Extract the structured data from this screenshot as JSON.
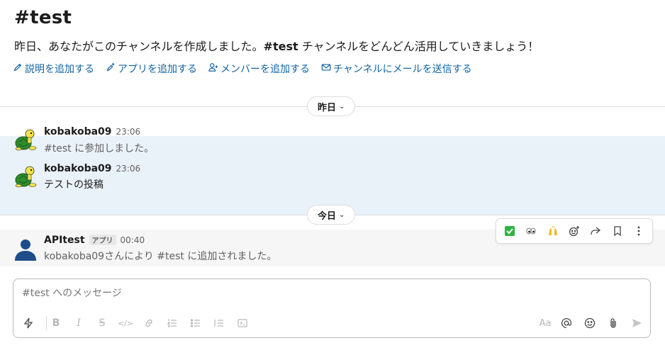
{
  "channel": {
    "title": "#test",
    "intro_before": "昨日、あなたがこのチャンネルを作成しました。",
    "intro_channel": "#test",
    "intro_after": " チャンネルをどんどん活用していきましょう！"
  },
  "actions": [
    {
      "label": "説明を追加する",
      "icon": "pencil-icon"
    },
    {
      "label": "アプリを追加する",
      "icon": "app-add-icon"
    },
    {
      "label": "メンバーを追加する",
      "icon": "person-add-icon"
    },
    {
      "label": "チャンネルにメールを送信する",
      "icon": "email-icon"
    }
  ],
  "dividers": {
    "yesterday": "昨日",
    "today": "今日"
  },
  "messages": [
    {
      "author": "kobakoba09",
      "time": "23:06",
      "text": "#test に参加しました。",
      "avatar": "turtle-avatar"
    },
    {
      "author": "kobakoba09",
      "time": "23:06",
      "text": "テストの投稿",
      "avatar": "turtle-avatar"
    },
    {
      "author": "APItest",
      "badge": "アプリ",
      "time": "00:40",
      "text": "kobakoba09さんにより #test に追加されました。",
      "avatar": "user-silhouette-avatar"
    }
  ],
  "hover_toolbar": [
    {
      "name": "check-mark-reaction",
      "glyph": "✅"
    },
    {
      "name": "eyes-reaction",
      "glyph": "👀"
    },
    {
      "name": "raised-hands-reaction",
      "glyph": "🙌"
    },
    {
      "name": "add-reaction-icon"
    },
    {
      "name": "share-icon"
    },
    {
      "name": "bookmark-icon"
    },
    {
      "name": "more-icon"
    }
  ],
  "composer": {
    "placeholder": "#test へのメッセージ",
    "format_label": "Aa"
  },
  "colors": {
    "link": "#1264a3",
    "highlight_bg": "#eaf2f9",
    "avatar_blue": "#1d4e89"
  }
}
